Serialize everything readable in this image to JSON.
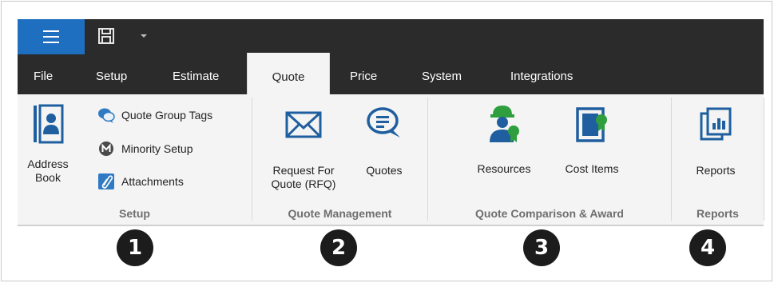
{
  "quick_access": {
    "menu_icon": "hamburger-icon",
    "save_icon": "save-icon",
    "dropdown_icon": "chevron-down-icon"
  },
  "tabs": [
    "File",
    "Setup",
    "Estimate",
    "Quote",
    "Price",
    "System",
    "Integrations"
  ],
  "active_tab": "Quote",
  "groups": {
    "setup": {
      "label": "Setup",
      "address_book": "Address\nBook",
      "quote_group_tags": "Quote Group Tags",
      "minority_setup": "Minority Setup",
      "attachments": "Attachments"
    },
    "quote_management": {
      "label": "Quote Management",
      "rfq": "Request For\nQuote (RFQ)",
      "quotes": "Quotes"
    },
    "comparison": {
      "label": "Quote Comparison & Award",
      "resources": "Resources",
      "cost_items": "Cost Items"
    },
    "reports": {
      "label": "Reports",
      "reports": "Reports"
    }
  },
  "badges": [
    "1",
    "2",
    "3",
    "4"
  ],
  "colors": {
    "accent": "#1f6fc1",
    "icon_blue": "#1f5f9f",
    "icon_green": "#2e9e3e",
    "dark_bar": "#2b2b2b"
  }
}
